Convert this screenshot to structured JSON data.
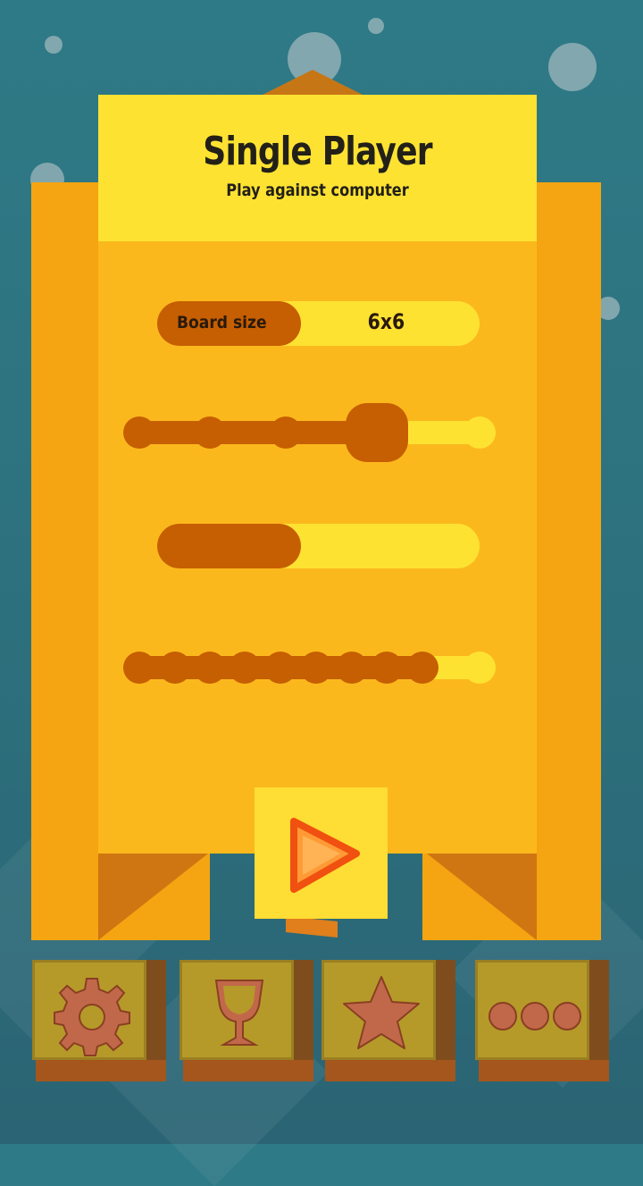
{
  "header": {
    "title": "Single Player",
    "subtitle": "Play against computer"
  },
  "settings": {
    "board_size": {
      "label": "Board size",
      "value": "6x6"
    },
    "slider_1": {
      "steps": 5,
      "selected_index": 3
    },
    "toggle_2": {
      "fill_fraction": 0.45
    },
    "slider_2": {
      "steps": 11,
      "selected_index": 8
    }
  },
  "actions": {
    "play": "play-icon",
    "bottom_bar": [
      "gear-icon",
      "trophy-icon",
      "star-icon",
      "more-icon"
    ]
  },
  "colors": {
    "card": "#fbb81d",
    "header": "#fee232",
    "accent": "#c65e02",
    "background": "#2e7a86"
  }
}
